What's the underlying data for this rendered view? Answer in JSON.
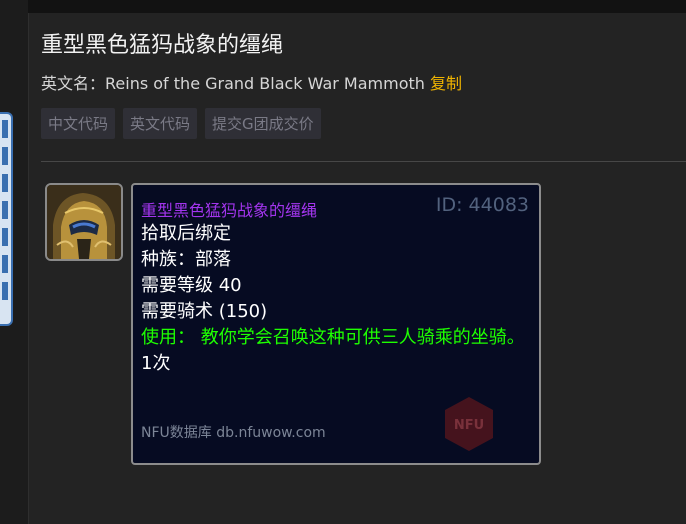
{
  "page": {
    "title": "重型黑色猛犸战象的缰绳",
    "english_name_label": "英文名：",
    "english_name": "Reins of the Grand Black War Mammoth",
    "copy_label": "复制"
  },
  "actions": [
    {
      "label": "中文代码"
    },
    {
      "label": "英文代码"
    },
    {
      "label": "提交G团成交价"
    }
  ],
  "item_icon": {
    "icon": "mammoth-helmet-icon"
  },
  "tooltip": {
    "name": "重型黑色猛犸战象的缰绳",
    "id": "ID: 44083",
    "lines": [
      "拾取后绑定",
      "种族：部落",
      "需要等级 40",
      "需要骑术 (150)"
    ],
    "use": "使用： 教你学会召唤这种可供三人骑乘的坐骑。",
    "count": "1次",
    "footer": "NFU数据库 db.nfuwow.com",
    "logo_text": "NFU"
  },
  "colors": {
    "background": "#232323",
    "tooltip_bg": "#060b22",
    "item_quality_epic": "#a335ee",
    "use_text": "#1eff00",
    "copy_link": "#f0b400"
  }
}
